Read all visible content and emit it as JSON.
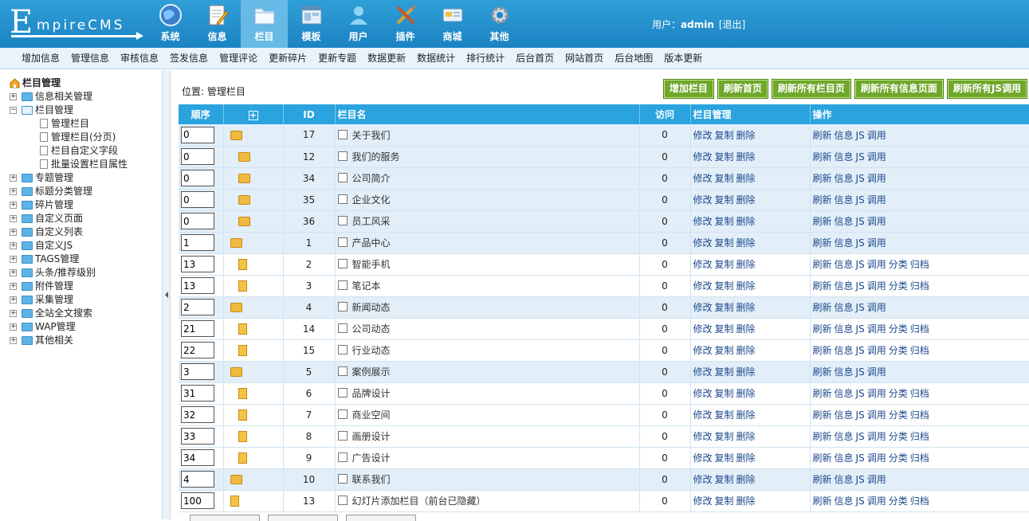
{
  "logo": {
    "letter": "E",
    "text": "mpireCMS"
  },
  "topnav": [
    {
      "label": "系统",
      "icon": "globe-icon",
      "active": false
    },
    {
      "label": "信息",
      "icon": "note-pencil-icon",
      "active": false
    },
    {
      "label": "栏目",
      "icon": "folder-icon",
      "active": true
    },
    {
      "label": "模板",
      "icon": "window-icon",
      "active": false
    },
    {
      "label": "用户",
      "icon": "user-icon",
      "active": false
    },
    {
      "label": "插件",
      "icon": "tools-icon",
      "active": false
    },
    {
      "label": "商城",
      "icon": "card-icon",
      "active": false
    },
    {
      "label": "其他",
      "icon": "gear-icon",
      "active": false
    }
  ],
  "user": {
    "label": "用户：",
    "name": "admin",
    "logout": "[退出]"
  },
  "submenu": [
    "增加信息",
    "管理信息",
    "审核信息",
    "签发信息",
    "管理评论",
    "更新碎片",
    "更新专题",
    "数据更新",
    "数据统计",
    "排行统计",
    "后台首页",
    "网站首页",
    "后台地图",
    "版本更新"
  ],
  "tree": {
    "root": "栏目管理",
    "n1": "信息相关管理",
    "n2": "栏目管理",
    "n2a": "管理栏目",
    "n2b": "管理栏目(分页)",
    "n2c": "栏目自定义字段",
    "n2d": "批量设置栏目属性",
    "n3": "专题管理",
    "n4": "标题分类管理",
    "n5": "碎片管理",
    "n6": "自定义页面",
    "n7": "自定义列表",
    "n8": "自定义JS",
    "n9": "TAGS管理",
    "n10": "头条/推荐级别",
    "n11": "附件管理",
    "n12": "采集管理",
    "n13": "全站全文搜索",
    "n14": "WAP管理",
    "n15": "其他相关"
  },
  "main": {
    "crumb": "位置: 管理栏目",
    "actions": [
      "增加栏目",
      "刷新首页",
      "刷新所有栏目页",
      "刷新所有信息页面",
      "刷新所有JS调用"
    ],
    "headers": {
      "order": "顺序",
      "plus": "+",
      "id": "ID",
      "name": "栏目名",
      "visits": "访问",
      "manage": "栏目管理",
      "ops": "操作"
    },
    "manage_links": [
      "修改",
      "复制",
      "删除"
    ],
    "op_links": [
      "刷新",
      "信息",
      "JS",
      "调用"
    ],
    "op_links_ext": [
      "分类",
      "归档"
    ]
  },
  "rows": [
    {
      "order": "0",
      "id": "17",
      "name": "关于我们",
      "visits": "0"
    },
    {
      "order": "0",
      "id": "12",
      "name": "我们的服务",
      "visits": "0"
    },
    {
      "order": "0",
      "id": "34",
      "name": "公司简介",
      "visits": "0"
    },
    {
      "order": "0",
      "id": "35",
      "name": "企业文化",
      "visits": "0"
    },
    {
      "order": "0",
      "id": "36",
      "name": "员工风采",
      "visits": "0"
    },
    {
      "order": "1",
      "id": "1",
      "name": "产品中心",
      "visits": "0"
    },
    {
      "order": "13",
      "id": "2",
      "name": "智能手机",
      "visits": "0"
    },
    {
      "order": "13",
      "id": "3",
      "name": "笔记本",
      "visits": "0"
    },
    {
      "order": "2",
      "id": "4",
      "name": "新闻动态",
      "visits": "0"
    },
    {
      "order": "21",
      "id": "14",
      "name": "公司动态",
      "visits": "0"
    },
    {
      "order": "22",
      "id": "15",
      "name": "行业动态",
      "visits": "0"
    },
    {
      "order": "3",
      "id": "5",
      "name": "案例展示",
      "visits": "0"
    },
    {
      "order": "31",
      "id": "6",
      "name": "品牌设计",
      "visits": "0"
    },
    {
      "order": "32",
      "id": "7",
      "name": "商业空间",
      "visits": "0"
    },
    {
      "order": "33",
      "id": "8",
      "name": "画册设计",
      "visits": "0"
    },
    {
      "order": "34",
      "id": "9",
      "name": "广告设计",
      "visits": "0"
    },
    {
      "order": "4",
      "id": "10",
      "name": "联系我们",
      "visits": "0"
    },
    {
      "order": "100",
      "id": "13",
      "name": "幻灯片添加栏目（前台已隐藏）",
      "visits": "0"
    }
  ]
}
